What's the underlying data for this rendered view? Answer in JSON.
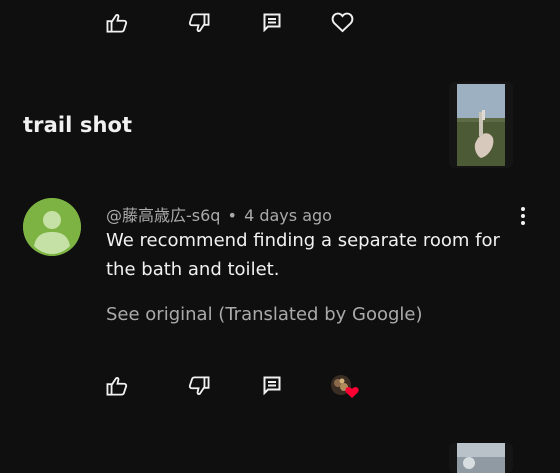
{
  "top_actions": {
    "like_icon": "thumbs-up-icon",
    "dislike_icon": "thumbs-down-icon",
    "reply_icon": "comment-icon",
    "heart_icon": "heart-outline-icon"
  },
  "section": {
    "title": "trail shot"
  },
  "comment": {
    "author": "@藤高歳広-s6q",
    "separator": "•",
    "time": "4 days ago",
    "text": "We recommend finding a separate room for the bath and toilet.",
    "see_original": "See original (Translated by Google)"
  },
  "bottom_actions": {
    "like_icon": "thumbs-up-icon",
    "dislike_icon": "thumbs-down-icon",
    "reply_icon": "comment-icon",
    "hearted_icon": "creator-heart-icon"
  },
  "colors": {
    "background": "#0f0f0f",
    "text_primary": "#f1f1f1",
    "text_secondary": "#aaaaaa",
    "avatar": "#7cb342",
    "heart": "#ff0033"
  }
}
